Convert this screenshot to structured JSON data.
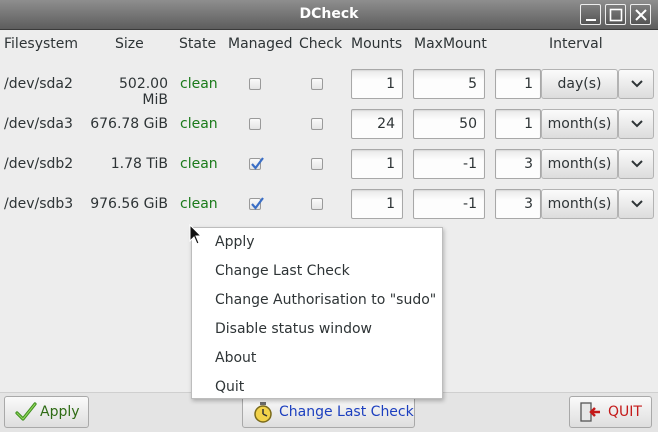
{
  "window": {
    "title": "DCheck"
  },
  "headers": {
    "filesystem": "Filesystem",
    "size": "Size",
    "state": "State",
    "managed": "Managed",
    "check": "Check",
    "mounts": "Mounts",
    "maxmount": "MaxMount",
    "interval": "Interval"
  },
  "rows": [
    {
      "filesystem": "/dev/sda2",
      "size": "502.00 MiB",
      "state": "clean",
      "managed": false,
      "check": false,
      "mounts": "1",
      "maxmount": "5",
      "interval_value": "1",
      "interval_unit": "day(s)"
    },
    {
      "filesystem": "/dev/sda3",
      "size": "676.78 GiB",
      "state": "clean",
      "managed": false,
      "check": false,
      "mounts": "24",
      "maxmount": "50",
      "interval_value": "1",
      "interval_unit": "month(s)"
    },
    {
      "filesystem": "/dev/sdb2",
      "size": "1.78 TiB",
      "state": "clean",
      "managed": true,
      "check": false,
      "mounts": "1",
      "maxmount": "-1",
      "interval_value": "3",
      "interval_unit": "month(s)"
    },
    {
      "filesystem": "/dev/sdb3",
      "size": "976.56 GiB",
      "state": "clean",
      "managed": true,
      "check": false,
      "mounts": "1",
      "maxmount": "-1",
      "interval_value": "3",
      "interval_unit": "month(s)"
    }
  ],
  "context_menu": {
    "items": [
      "Apply",
      "Change Last Check",
      "Change Authorisation to \"sudo\"",
      "Disable status window",
      "About",
      "Quit"
    ]
  },
  "buttons": {
    "apply": "Apply",
    "change_last_check": "Change Last Check",
    "quit": "QUIT"
  },
  "colors": {
    "state_clean": "#1a7a1a",
    "link_blue": "#1c3fbf",
    "quit_red": "#c41a1a",
    "check_blue": "#3b6fc6"
  }
}
